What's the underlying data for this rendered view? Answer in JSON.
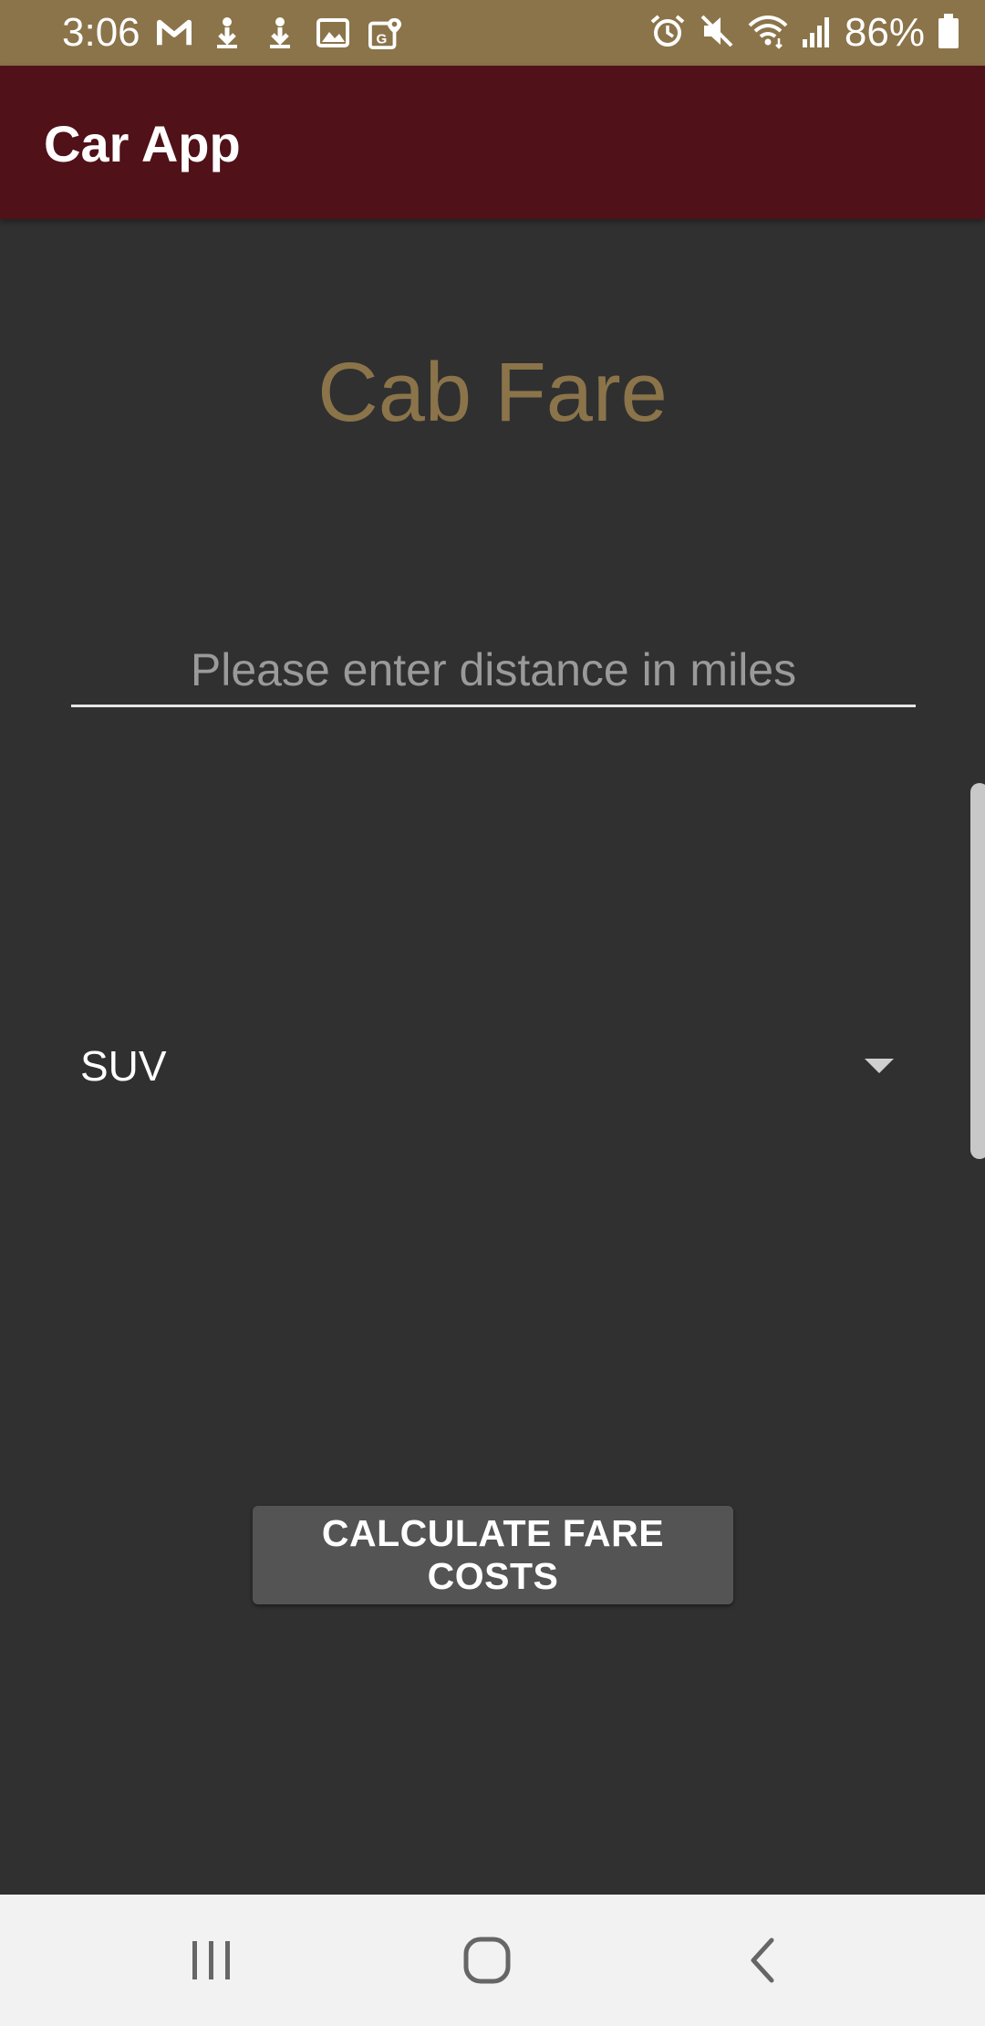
{
  "status_bar": {
    "time": "3:06",
    "battery_percent": "86%",
    "left_icons": [
      "gmail-icon",
      "download-icon",
      "download-icon",
      "image-icon",
      "maps-icon"
    ],
    "right_icons": [
      "alarm-icon",
      "mute-icon",
      "wifi-icon",
      "signal-icon",
      "battery-icon"
    ]
  },
  "app_bar": {
    "title": "Car App"
  },
  "main": {
    "title": "Cab Fare",
    "distance_input": {
      "placeholder": "Please enter distance in miles",
      "value": ""
    },
    "car_type_select": {
      "selected": "SUV"
    },
    "calculate_button_label": "CALCULATE FARE COSTS"
  },
  "nav_bar": {
    "buttons": [
      "recent-apps-icon",
      "home-icon",
      "back-icon"
    ]
  },
  "colors": {
    "status_bar": "#8b744a",
    "app_bar": "#511118",
    "background": "#303030",
    "accent": "#8b744a",
    "button": "#545454"
  }
}
